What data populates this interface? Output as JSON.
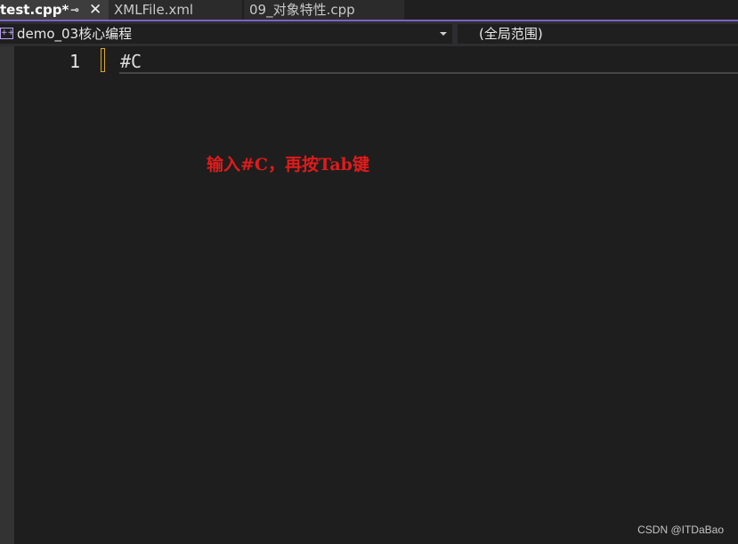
{
  "tabs": [
    {
      "label": "test.cpp*",
      "active": true
    },
    {
      "label": "XMLFile.xml",
      "active": false
    },
    {
      "label": "09_对象特性.cpp",
      "active": false
    }
  ],
  "tab_icons": {
    "pin": "pin-icon",
    "close": "close-icon"
  },
  "navbar": {
    "project_icon": "cpp-project-icon",
    "project_label": "demo_03核心编程",
    "scope_label": "(全局范围)"
  },
  "editor": {
    "line_number": "1",
    "code": "#C"
  },
  "annotation": "输入#C，再按Tab键",
  "watermark": "CSDN @ITDaBao",
  "colors": {
    "accent": "#7a62c4",
    "annotation": "#e01b1b",
    "background": "#1e1e1e",
    "change_marker": "#d9a72b"
  }
}
